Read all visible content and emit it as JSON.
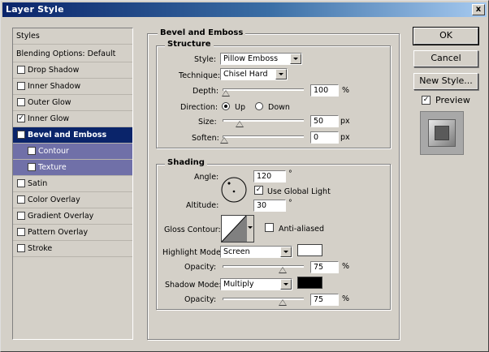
{
  "window": {
    "title": "Layer Style",
    "close_label": "x"
  },
  "styles_list": {
    "header": "Styles",
    "blending": "Blending Options: Default",
    "items": [
      {
        "label": "Drop Shadow",
        "checked": false
      },
      {
        "label": "Inner Shadow",
        "checked": false
      },
      {
        "label": "Outer Glow",
        "checked": false
      },
      {
        "label": "Inner Glow",
        "checked": true
      },
      {
        "label": "Bevel and Emboss",
        "checked": true
      },
      {
        "label": "Contour",
        "checked": false
      },
      {
        "label": "Texture",
        "checked": false
      },
      {
        "label": "Satin",
        "checked": false
      },
      {
        "label": "Color Overlay",
        "checked": false
      },
      {
        "label": "Gradient Overlay",
        "checked": false
      },
      {
        "label": "Pattern Overlay",
        "checked": false
      },
      {
        "label": "Stroke",
        "checked": false
      }
    ],
    "check_mark": "✓"
  },
  "bevel": {
    "title": "Bevel and Emboss",
    "structure": {
      "title": "Structure",
      "style_label": "Style:",
      "style_value": "Pillow Emboss",
      "technique_label": "Technique:",
      "technique_value": "Chisel Hard",
      "depth_label": "Depth:",
      "depth_value": "100",
      "depth_unit": "%",
      "depth_level": 0.02,
      "direction_label": "Direction:",
      "direction_up": "Up",
      "direction_down": "Down",
      "size_label": "Size:",
      "size_value": "50",
      "size_unit": "px",
      "size_level": 0.2,
      "soften_label": "Soften:",
      "soften_value": "0",
      "soften_unit": "px",
      "soften_level": 0
    },
    "shading": {
      "title": "Shading",
      "angle_label": "Angle:",
      "angle_value": "120",
      "angle_unit": "°",
      "global_light_label": "Use Global Light",
      "altitude_label": "Altitude:",
      "altitude_value": "30",
      "altitude_unit": "°",
      "gloss_label": "Gloss Contour:",
      "anti_aliased_label": "Anti-aliased",
      "highlight_label": "Highlight Mode:",
      "highlight_value": "Screen",
      "highlight_opacity_label": "Opacity:",
      "highlight_opacity_value": "75",
      "highlight_opacity_unit": "%",
      "highlight_level": 0.75,
      "shadow_label": "Shadow Mode:",
      "shadow_value": "Multiply",
      "shadow_opacity_label": "Opacity:",
      "shadow_opacity_value": "75",
      "shadow_opacity_unit": "%",
      "shadow_level": 0.75,
      "highlight_color": "#ffffff",
      "shadow_color": "#000000"
    }
  },
  "buttons": {
    "ok": "OK",
    "cancel": "Cancel",
    "new_style": "New Style...",
    "preview": "Preview"
  },
  "accent": {
    "selection": "#0a246a",
    "sub_selection": "#7070a8"
  }
}
